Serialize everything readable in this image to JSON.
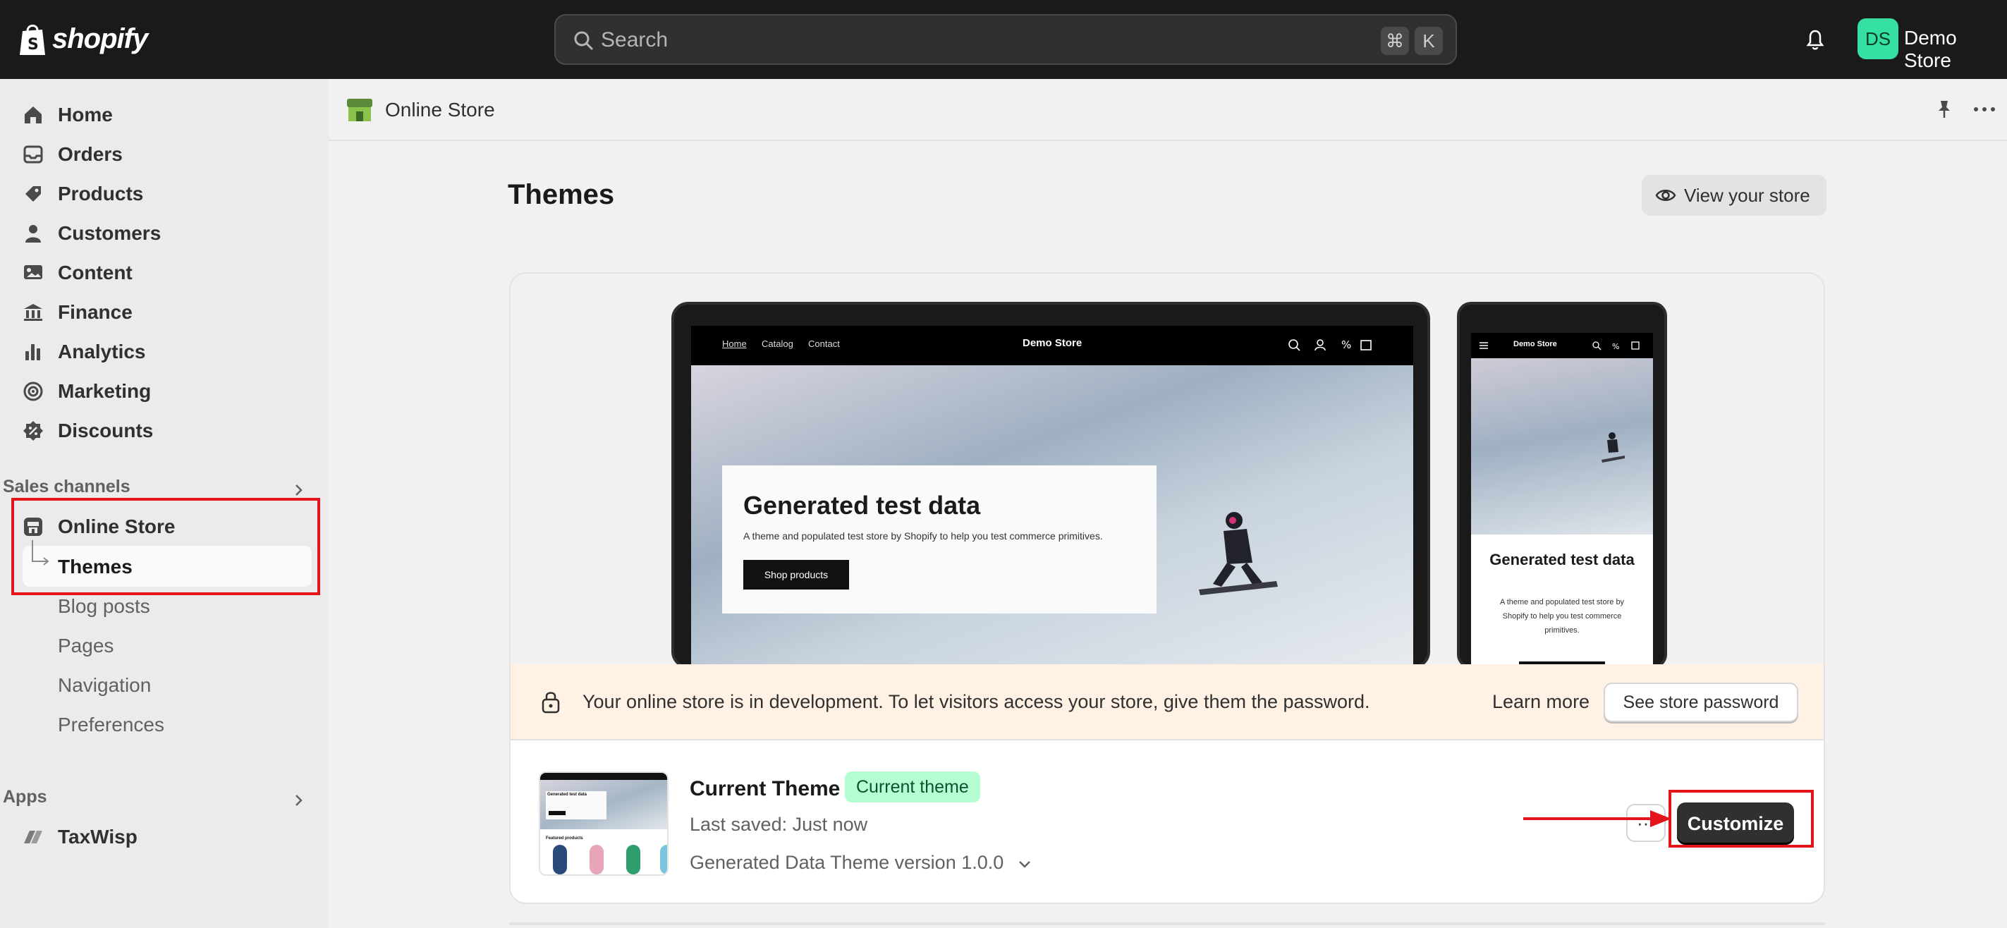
{
  "topbar": {
    "logo_text": "shopify",
    "search_placeholder": "Search",
    "shortcut_cmd": "⌘",
    "shortcut_key": "K",
    "avatar_initials": "DS",
    "store_name": "Demo Store"
  },
  "sidebar": {
    "items": [
      {
        "label": "Home",
        "icon": "home-icon"
      },
      {
        "label": "Orders",
        "icon": "orders-icon"
      },
      {
        "label": "Products",
        "icon": "tag-icon"
      },
      {
        "label": "Customers",
        "icon": "person-icon"
      },
      {
        "label": "Content",
        "icon": "content-icon"
      },
      {
        "label": "Finance",
        "icon": "bank-icon"
      },
      {
        "label": "Analytics",
        "icon": "bar-chart-icon"
      },
      {
        "label": "Marketing",
        "icon": "target-icon"
      },
      {
        "label": "Discounts",
        "icon": "discount-icon"
      }
    ],
    "sales_channels_label": "Sales channels",
    "online_store": "Online Store",
    "sub_items": [
      "Themes",
      "Blog posts",
      "Pages",
      "Navigation",
      "Preferences"
    ],
    "apps_label": "Apps",
    "app_item": "TaxWisp"
  },
  "subheader": {
    "title": "Online Store"
  },
  "main": {
    "page_title": "Themes",
    "view_store_label": "View your store",
    "preview": {
      "nav_links": [
        "Home",
        "Catalog",
        "Contact"
      ],
      "brand": "Demo Store",
      "hero_title": "Generated test data",
      "hero_text": "A theme and populated test store by Shopify to help you test commerce primitives.",
      "hero_button": "Shop products",
      "phone_title": "Generated test data",
      "phone_text": "A theme and populated test store by Shopify to help you test commerce primitives."
    },
    "banner": {
      "message": "Your online store is in development. To let visitors access your store, give them the password.",
      "learn_more": "Learn more",
      "password_button": "See store password"
    },
    "theme": {
      "name": "Current Theme",
      "badge": "Current theme",
      "last_saved": "Last saved: Just now",
      "version": "Generated Data Theme version 1.0.0",
      "more_label": "···",
      "customize_label": "Customize",
      "thumb_title": "Generated test data",
      "thumb_section": "Featured products"
    }
  },
  "colors": {
    "topbar": "#1a1a1a",
    "accent_green": "#36e0a3",
    "annotation_red": "#e4141b",
    "badge_bg": "#b4fed2",
    "banner_bg": "#fff1e3"
  }
}
